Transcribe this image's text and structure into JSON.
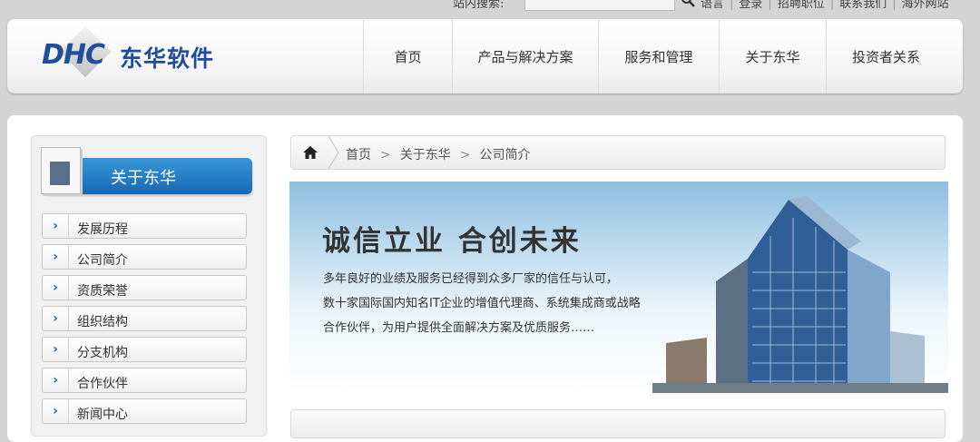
{
  "topbar": {
    "search_label": "站内搜索:",
    "search_value": "",
    "links": [
      "语言",
      "登录",
      "招聘职位",
      "联系我们",
      "海外网站"
    ]
  },
  "header": {
    "logo_text": "DHC",
    "logo_name": "东华软件",
    "nav": [
      "首页",
      "产品与解决方案",
      "服务和管理",
      "关于东华",
      "投资者关系"
    ]
  },
  "sidebar": {
    "title": "关于东华",
    "items": [
      "发展历程",
      "公司简介",
      "资质荣誉",
      "组织结构",
      "分支机构",
      "合作伙伴",
      "新闻中心"
    ]
  },
  "breadcrumb": [
    "首页",
    "关于东华",
    "公司简介"
  ],
  "banner": {
    "title": "诚信立业 合创未来",
    "lines": [
      "多年良好的业绩及服务已经得到众多厂家的信任与认可，",
      "数十家国际国内知名IT企业的增值代理商、系统集成商或战略",
      "合作伙伴，为用户提供全面解决方案及优质服务……"
    ]
  },
  "colors": {
    "brand": "#1f4e9a",
    "sidebar_header": "#1768b3",
    "page_bg": "#d4d4d4"
  }
}
